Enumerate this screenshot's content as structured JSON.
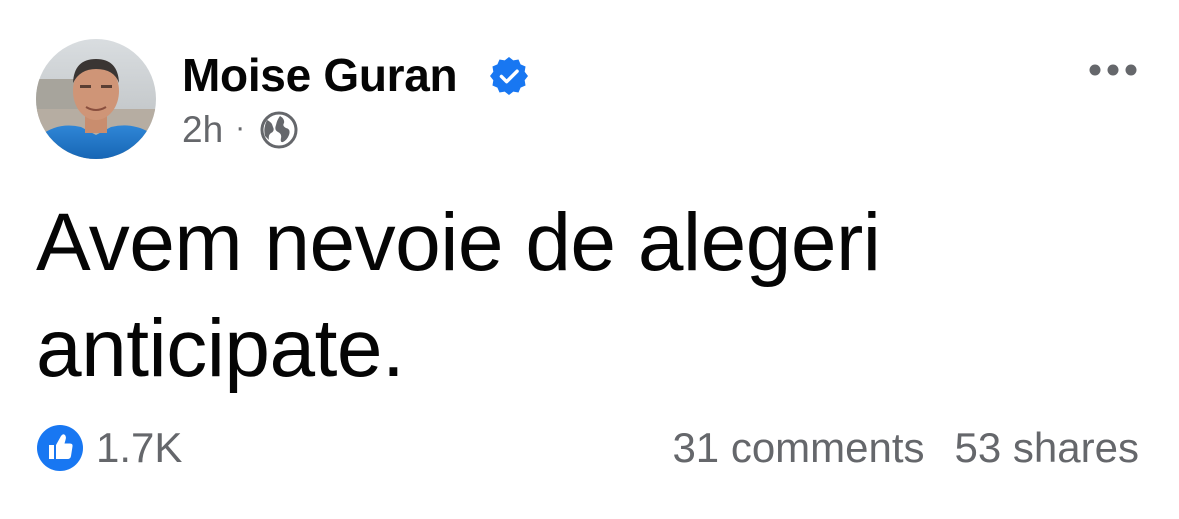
{
  "author": {
    "name": "Moise Guran",
    "verified": true,
    "avatar_icon": "profile-photo"
  },
  "meta": {
    "time": "2h",
    "separator": "·",
    "audience_icon": "globe-icon"
  },
  "post": {
    "text_line1": "Avem nevoie de alegeri",
    "text_line2": "anticipate."
  },
  "reactions": {
    "icon": "like-icon",
    "count": "1.7K"
  },
  "stats": {
    "comments": "31 comments",
    "shares": "53 shares"
  },
  "colors": {
    "accent": "#1877F2",
    "secondary_text": "#65676B",
    "primary_text": "#050505"
  }
}
